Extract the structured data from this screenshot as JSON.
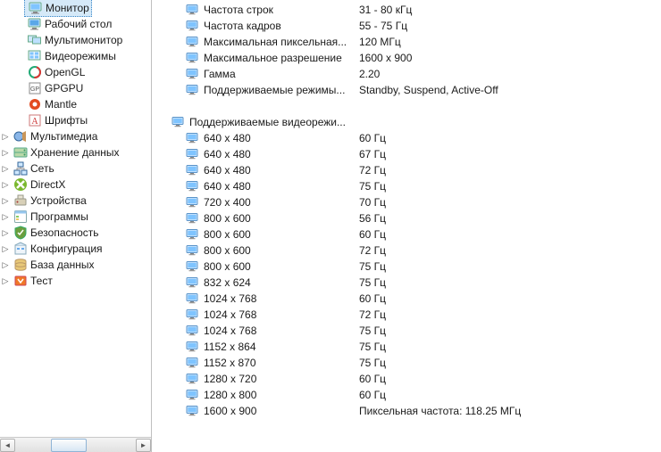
{
  "sidebar": {
    "items": [
      {
        "label": "Монитор",
        "icon": "monitor",
        "indent": 2,
        "selected": true,
        "expander": ""
      },
      {
        "label": "Рабочий стол",
        "icon": "desktop",
        "indent": 2,
        "expander": ""
      },
      {
        "label": "Мультимонитор",
        "icon": "multimonitor",
        "indent": 2,
        "expander": ""
      },
      {
        "label": "Видеорежимы",
        "icon": "videomodes",
        "indent": 2,
        "expander": ""
      },
      {
        "label": "OpenGL",
        "icon": "opengl",
        "indent": 2,
        "expander": ""
      },
      {
        "label": "GPGPU",
        "icon": "gpgpu",
        "indent": 2,
        "expander": ""
      },
      {
        "label": "Mantle",
        "icon": "mantle",
        "indent": 2,
        "expander": ""
      },
      {
        "label": "Шрифты",
        "icon": "fonts",
        "indent": 2,
        "expander": ""
      },
      {
        "label": "Мультимедиа",
        "icon": "multimedia",
        "indent": 1,
        "expander": "▷"
      },
      {
        "label": "Хранение данных",
        "icon": "storage",
        "indent": 1,
        "expander": "▷"
      },
      {
        "label": "Сеть",
        "icon": "network",
        "indent": 1,
        "expander": "▷"
      },
      {
        "label": "DirectX",
        "icon": "directx",
        "indent": 1,
        "expander": "▷"
      },
      {
        "label": "Устройства",
        "icon": "devices",
        "indent": 1,
        "expander": "▷"
      },
      {
        "label": "Программы",
        "icon": "programs",
        "indent": 1,
        "expander": "▷"
      },
      {
        "label": "Безопасность",
        "icon": "security",
        "indent": 1,
        "expander": "▷"
      },
      {
        "label": "Конфигурация",
        "icon": "config",
        "indent": 1,
        "expander": "▷"
      },
      {
        "label": "База данных",
        "icon": "database",
        "indent": 1,
        "expander": "▷"
      },
      {
        "label": "Тест",
        "icon": "test",
        "indent": 1,
        "expander": "▷"
      }
    ]
  },
  "props": [
    {
      "label": "Частота строк",
      "value": "31 - 80 кГц"
    },
    {
      "label": "Частота кадров",
      "value": "55 - 75 Гц"
    },
    {
      "label": "Максимальная пиксельная...",
      "value": "120 МГц"
    },
    {
      "label": "Максимальное разрешение",
      "value": "1600 x 900"
    },
    {
      "label": "Гамма",
      "value": "2.20"
    },
    {
      "label": "Поддерживаемые режимы...",
      "value": "Standby, Suspend, Active-Off"
    }
  ],
  "modes_section_label": "Поддерживаемые видеорежи...",
  "modes": [
    {
      "res": "640 x 480",
      "hz": "60 Гц"
    },
    {
      "res": "640 x 480",
      "hz": "67 Гц"
    },
    {
      "res": "640 x 480",
      "hz": "72 Гц"
    },
    {
      "res": "640 x 480",
      "hz": "75 Гц"
    },
    {
      "res": "720 x 400",
      "hz": "70 Гц"
    },
    {
      "res": "800 x 600",
      "hz": "56 Гц"
    },
    {
      "res": "800 x 600",
      "hz": "60 Гц"
    },
    {
      "res": "800 x 600",
      "hz": "72 Гц"
    },
    {
      "res": "800 x 600",
      "hz": "75 Гц"
    },
    {
      "res": "832 x 624",
      "hz": "75 Гц"
    },
    {
      "res": "1024 x 768",
      "hz": "60 Гц"
    },
    {
      "res": "1024 x 768",
      "hz": "72 Гц"
    },
    {
      "res": "1024 x 768",
      "hz": "75 Гц"
    },
    {
      "res": "1152 x 864",
      "hz": "75 Гц"
    },
    {
      "res": "1152 x 870",
      "hz": "75 Гц"
    },
    {
      "res": "1280 x 720",
      "hz": "60 Гц"
    },
    {
      "res": "1280 x 800",
      "hz": "60 Гц"
    },
    {
      "res": "1600 x 900",
      "hz": "Пиксельная частота: 118.25 МГц"
    }
  ]
}
